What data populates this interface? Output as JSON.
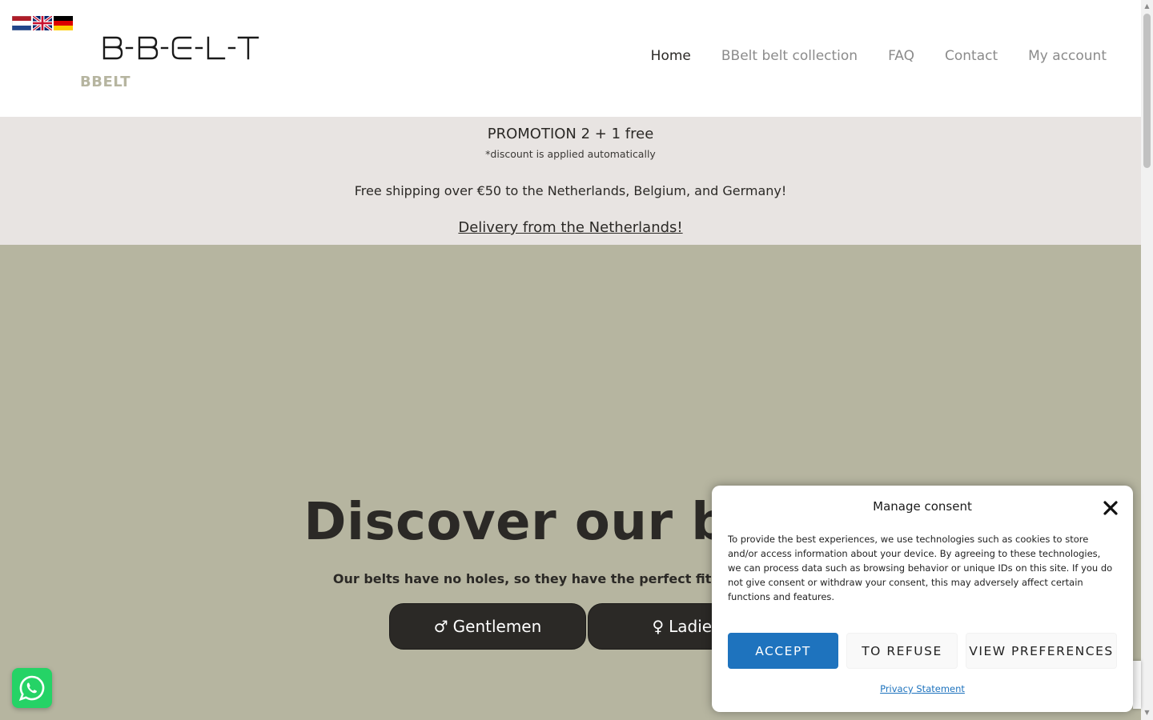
{
  "header": {
    "languages": [
      "Nederlands",
      "English",
      "Deutsch"
    ],
    "logo_text": "B-B-E-L-T",
    "site_name": "BBELT",
    "nav": [
      {
        "label": "Home",
        "active": true
      },
      {
        "label": "BBelt belt collection",
        "active": false
      },
      {
        "label": "FAQ",
        "active": false
      },
      {
        "label": "Contact",
        "active": false
      },
      {
        "label": "My account",
        "active": false
      }
    ]
  },
  "promo": {
    "title": "PROMOTION 2 + 1 free",
    "note": "*discount is applied automatically",
    "shipping": "Free shipping over €50 to the Netherlands, Belgium, and Germany!",
    "delivery": "Delivery from the Netherlands!"
  },
  "hero": {
    "title": "Discover our belts",
    "subtitle": "Our belts have no holes, so they have the perfect fit for everyone",
    "buttons": [
      {
        "icon": "male-symbol-icon",
        "symbol": "♂",
        "label": "Gentlemen"
      },
      {
        "icon": "female-symbol-icon",
        "symbol": "♀",
        "label": "Ladies"
      }
    ]
  },
  "consent": {
    "title": "Manage consent",
    "text": "To provide the best experiences, we use technologies such as cookies to store and/or access information about your device. By agreeing to these technologies, we can process data such as browsing behavior or unique IDs on this site. If you do not give consent or withdraw your consent, this may adversely affect certain functions and features.",
    "accept_label": "ACCEPT",
    "refuse_label": "TO REFUSE",
    "preferences_label": "VIEW PREFERENCES",
    "privacy_label": "Privacy Statement"
  },
  "colors": {
    "hero_bg": "#b6b5a0",
    "promo_bg": "#e8e4e2",
    "dark": "#2b2926",
    "accept_blue": "#1e73be",
    "whatsapp_green": "#25d366"
  }
}
